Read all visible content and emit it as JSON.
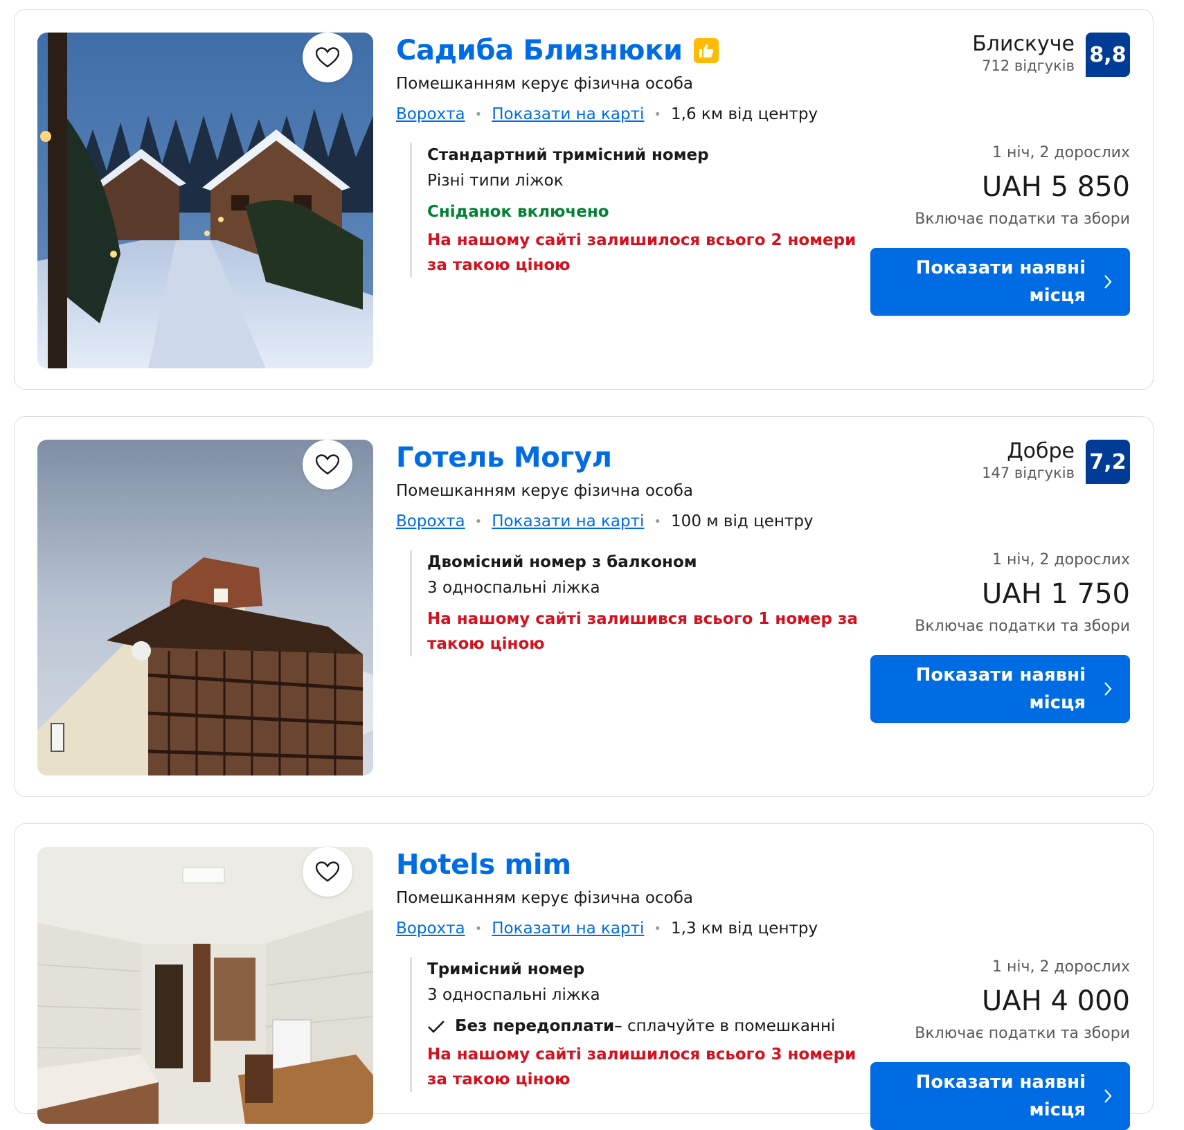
{
  "colors": {
    "link": "#006ce4",
    "score_bg": "#003b95",
    "success": "#008234",
    "urgent": "#d4111e",
    "badge": "#febb02"
  },
  "listings": [
    {
      "name": "Садиба Близнюки",
      "has_thumb_badge": true,
      "host": "Помешканням керує фізична особа",
      "town": "Ворохта",
      "map_link": "Показати на карті",
      "distance": "1,6 км від центру",
      "review_word": "Блискуче",
      "review_count": "712 відгуків",
      "score": "8,8",
      "room_name": "Стандартний тримісний номер",
      "room_beds": "Різні типи ліжок",
      "breakfast": "Сніданок включено",
      "urgency": "На нашому сайті залишилося всього 2 номери за такою ціною",
      "stay": "1 ніч, 2 дорослих",
      "price": "UAH 5 850",
      "taxes": "Включає податки та збори",
      "button": "Показати наявні місця",
      "image": "snowy-chalets"
    },
    {
      "name": "Готель Могул",
      "has_thumb_badge": false,
      "host": "Помешканням керує фізична особа",
      "town": "Ворохта",
      "map_link": "Показати на карті",
      "distance": "100 м від центру",
      "review_word": "Добре",
      "review_count": "147 відгуків",
      "score": "7,2",
      "room_name": "Двомісний номер з балконом",
      "room_beds": "3 односпальні ліжка",
      "urgency": "На нашому сайті залишився всього 1 номер за такою ціною",
      "stay": "1 ніч, 2 дорослих",
      "price": "UAH 1 750",
      "taxes": "Включає податки та збори",
      "button": "Показати наявні місця",
      "image": "hotel-balconies"
    },
    {
      "name": "Hotels mim",
      "has_thumb_badge": false,
      "host": "Помешканням керує фізична особа",
      "town": "Ворохта",
      "map_link": "Показати на карті",
      "distance": "1,3 км від центру",
      "room_name": "Тримісний номер",
      "room_beds": "3 односпальні ліжка",
      "no_prepay_bold": "Без передоплати",
      "no_prepay_rest": " – сплачуйте в помешканні",
      "urgency": "На нашому сайті залишилося всього 3 номери за такою ціною",
      "stay": "1 ніч, 2 дорослих",
      "price": "UAH 4 000",
      "taxes": "Включає податки та збори",
      "button": "Показати наявні місця",
      "image": "room-interior"
    }
  ]
}
